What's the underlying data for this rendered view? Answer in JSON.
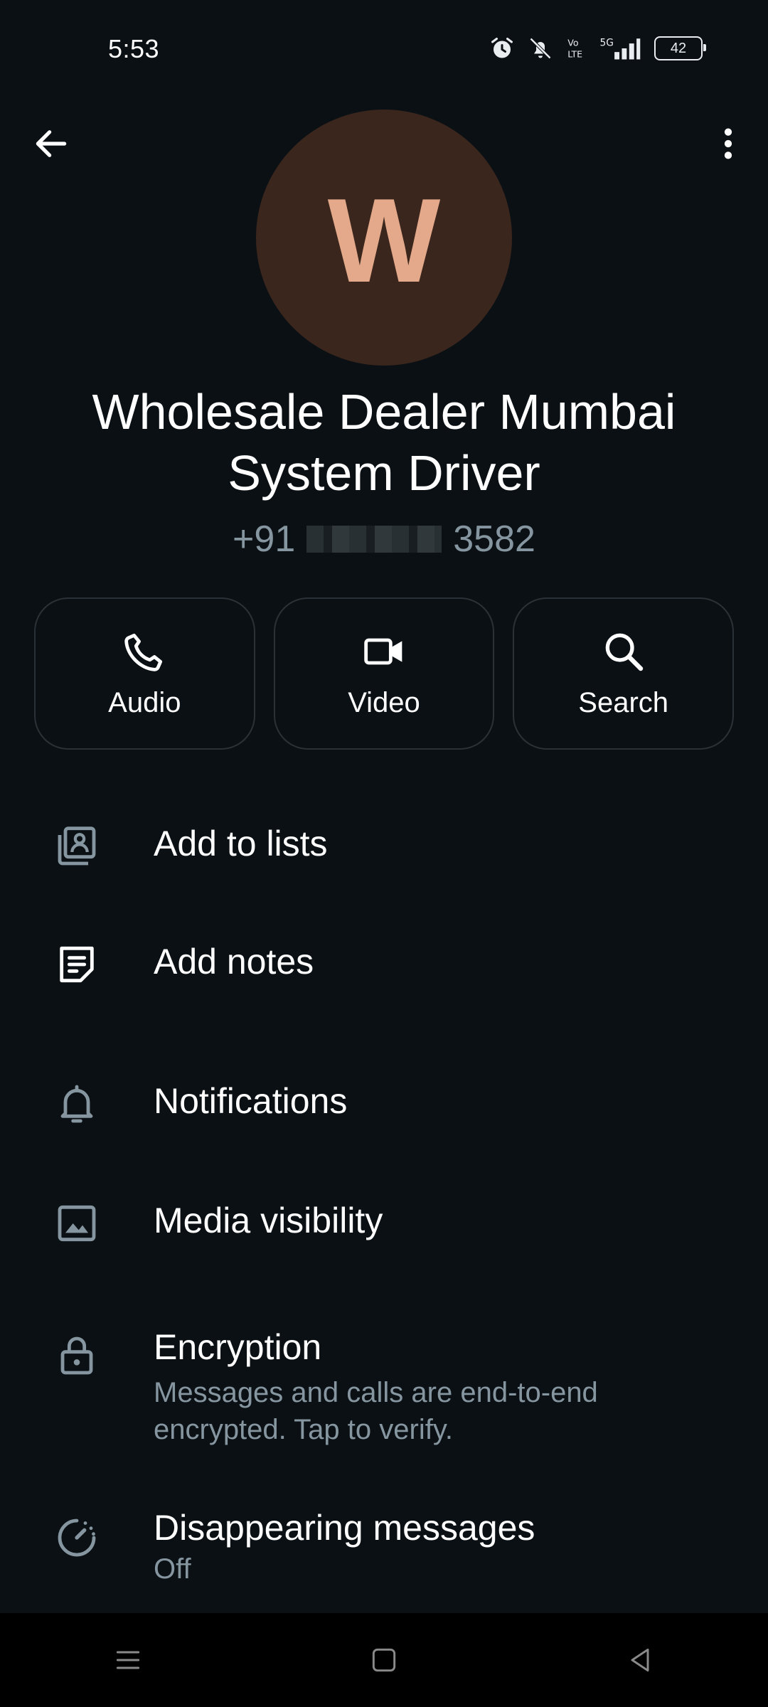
{
  "status_bar": {
    "time": "5:53",
    "battery": "42",
    "network": "5G"
  },
  "profile": {
    "avatar_letter": "W",
    "name": "Wholesale Dealer Mumbai System Driver",
    "phone_prefix": "+91",
    "phone_suffix": "3582"
  },
  "actions": [
    {
      "label": "Audio",
      "icon": "phone-icon"
    },
    {
      "label": "Video",
      "icon": "video-icon"
    },
    {
      "label": "Search",
      "icon": "search-icon"
    }
  ],
  "menu": {
    "add_to_lists": "Add to lists",
    "add_notes": "Add notes",
    "notifications": "Notifications",
    "media_visibility": "Media visibility",
    "encryption_title": "Encryption",
    "encryption_sub": "Messages and calls are end-to-end encrypted. Tap to verify.",
    "disappearing_title": "Disappearing messages",
    "disappearing_sub": "Off"
  },
  "colors": {
    "background": "#0b1014",
    "avatar_bg": "#3a261d",
    "avatar_letter": "#e3a98a",
    "secondary_text": "#8696a0"
  }
}
